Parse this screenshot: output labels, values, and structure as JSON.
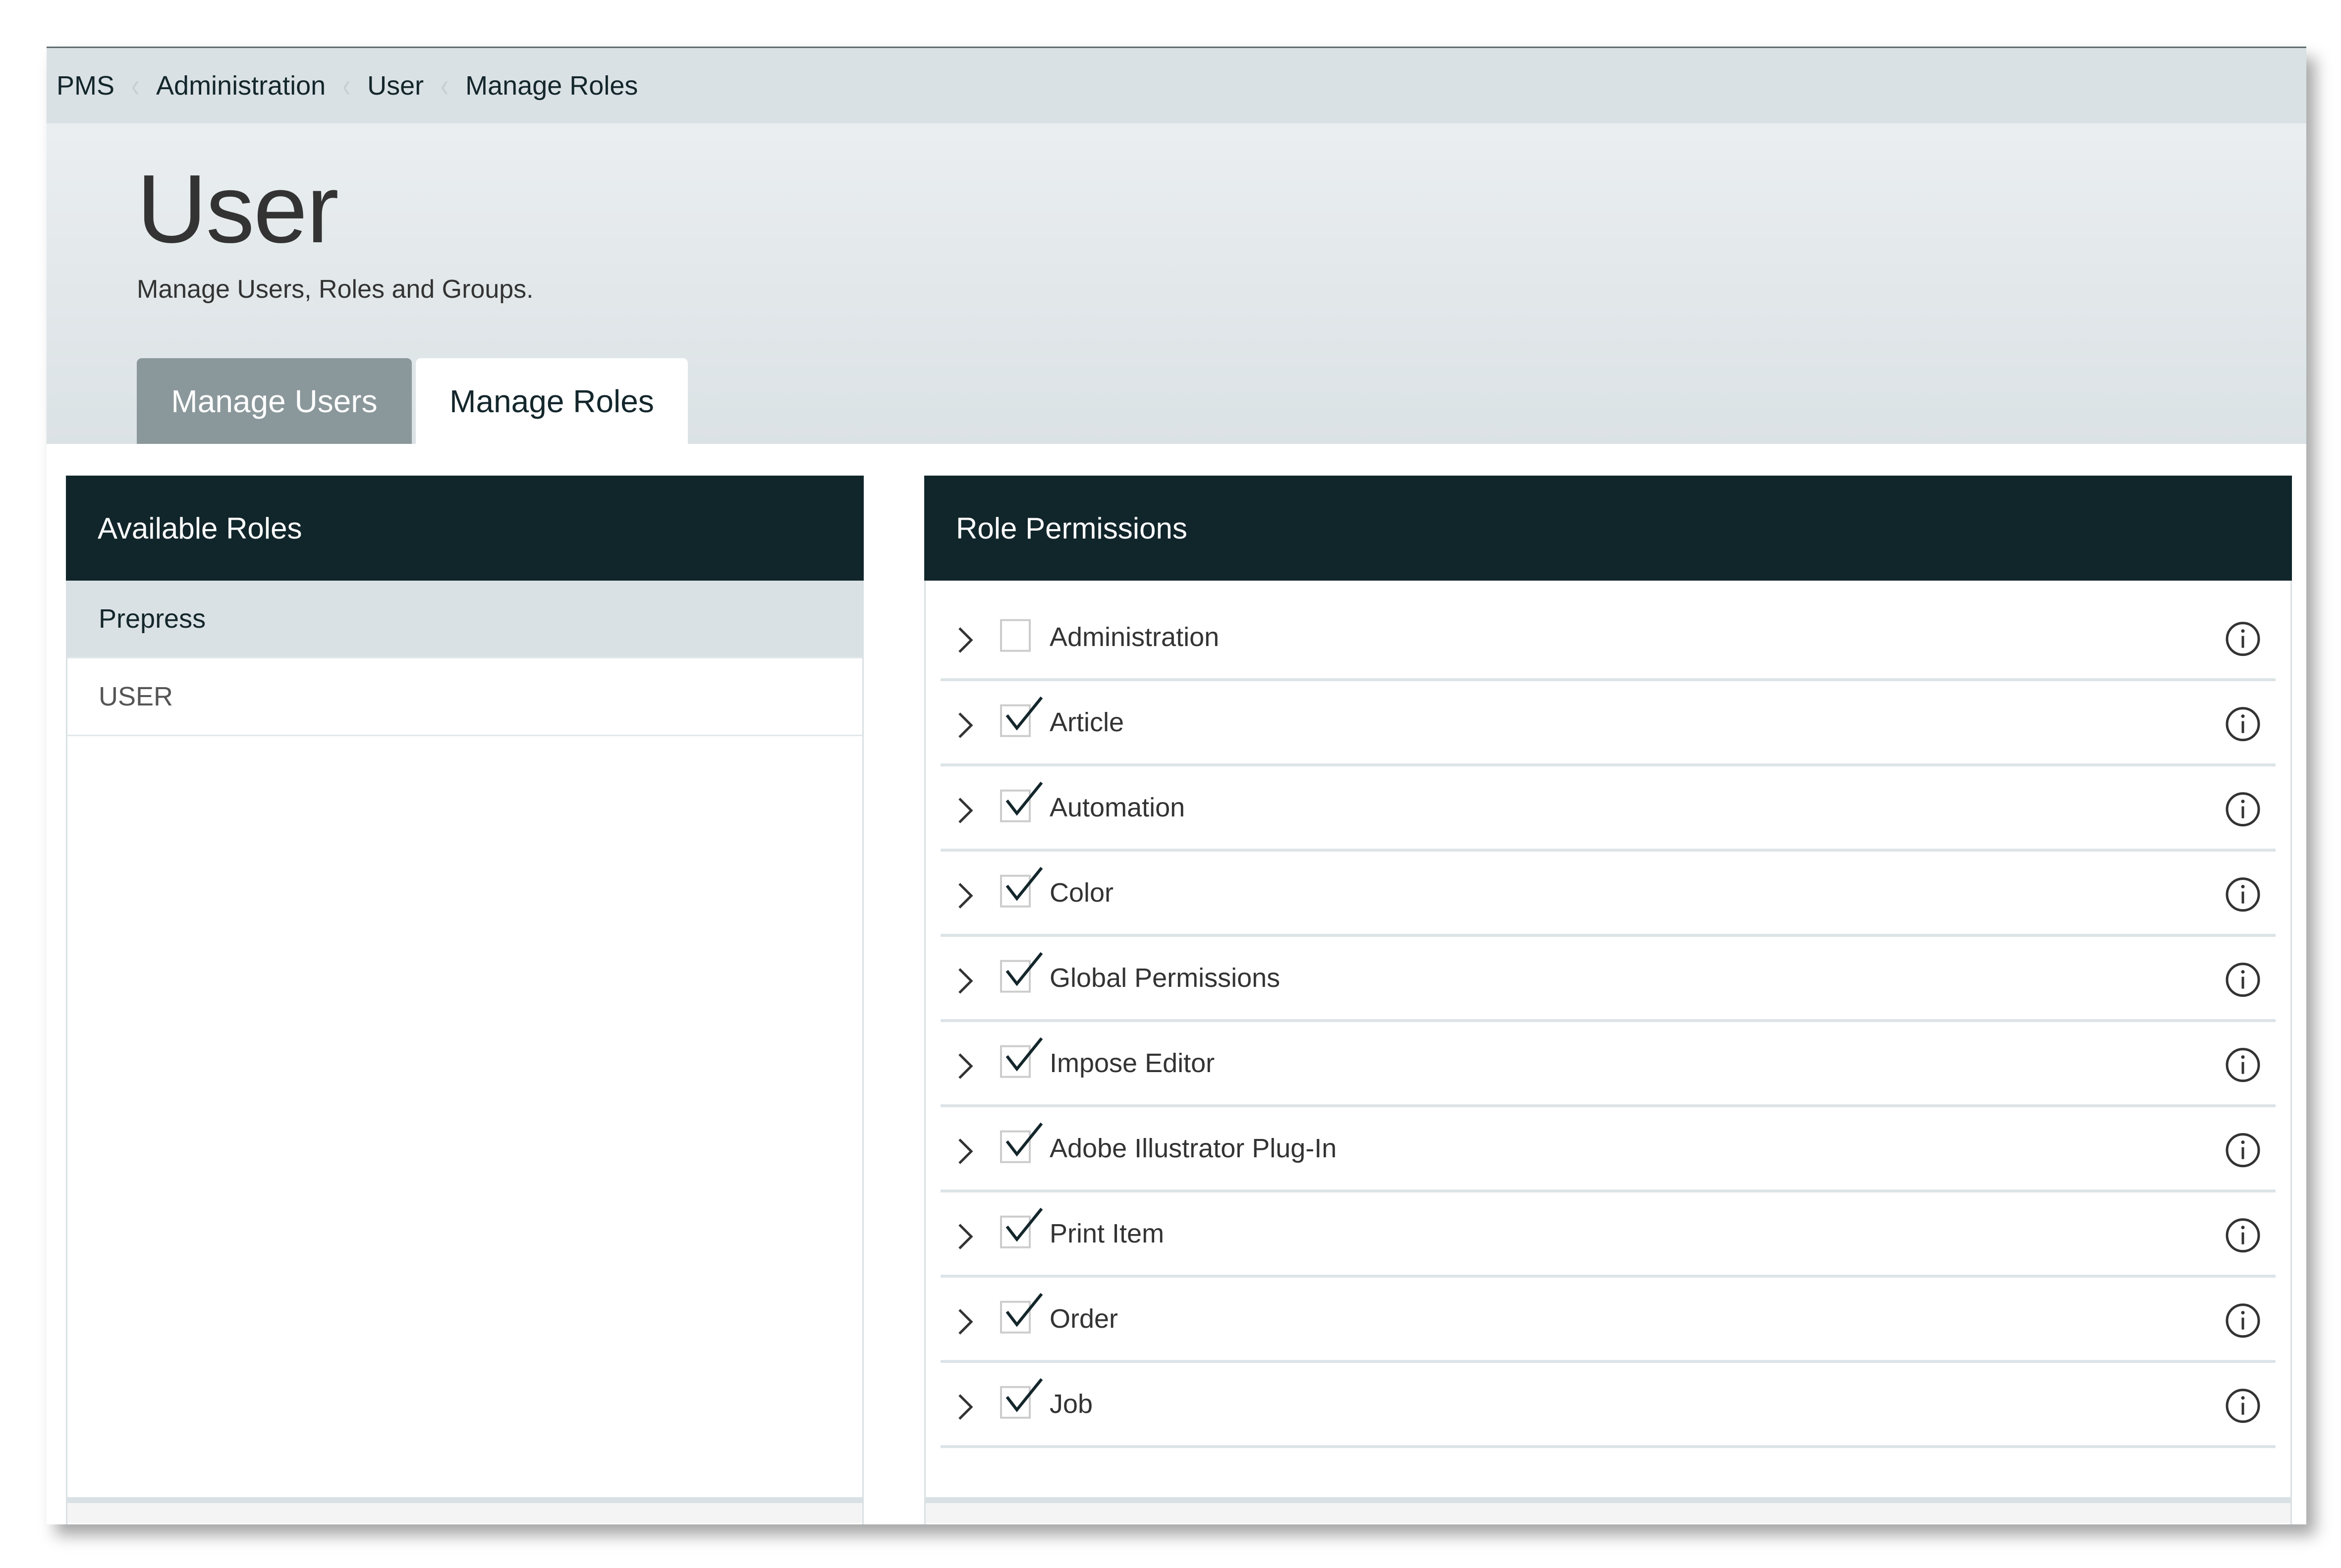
{
  "breadcrumb": [
    "PMS",
    "Administration",
    "User",
    "Manage Roles"
  ],
  "header": {
    "title": "User",
    "subtitle": "Manage Users, Roles and Groups."
  },
  "tabs": [
    {
      "label": "Manage Users",
      "active": false
    },
    {
      "label": "Manage Roles",
      "active": true
    }
  ],
  "available_roles": {
    "title": "Available Roles",
    "items": [
      {
        "label": "Prepress",
        "selected": true
      },
      {
        "label": "USER",
        "selected": false
      }
    ]
  },
  "role_permissions": {
    "title": "Role Permissions",
    "items": [
      {
        "label": "Administration",
        "checked": false
      },
      {
        "label": "Article",
        "checked": true
      },
      {
        "label": "Automation",
        "checked": true
      },
      {
        "label": "Color",
        "checked": true
      },
      {
        "label": "Global Permissions",
        "checked": true
      },
      {
        "label": "Impose Editor",
        "checked": true
      },
      {
        "label": "Adobe Illustrator Plug-In",
        "checked": true
      },
      {
        "label": "Print Item",
        "checked": true
      },
      {
        "label": "Order",
        "checked": true
      },
      {
        "label": "Job",
        "checked": true
      }
    ],
    "row_icons": {
      "expand": "chevron-right-icon",
      "info": "info-circle-icon"
    }
  },
  "colors": {
    "panel_header_bg": "#11262b",
    "breadcrumb_bg": "#dae1e4",
    "inactive_tab_bg": "#8a979b",
    "selected_role_bg": "#dae1e4"
  }
}
